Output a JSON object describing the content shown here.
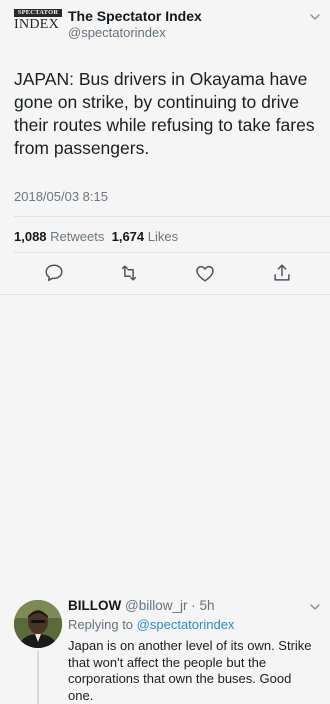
{
  "tweet": {
    "logo_top": "SPECTATOR",
    "logo_bottom": "INDEX",
    "name": "The Spectator Index",
    "handle": "@spectatorindex",
    "text": "JAPAN: Bus drivers in Okayama  have gone on strike, by continuing to drive their routes while refusing to take fares from passengers.",
    "timestamp": "2018/05/03 8:15",
    "retweets_count": "1,088",
    "retweets_label": "Retweets",
    "likes_count": "1,674",
    "likes_label": "Likes"
  },
  "actions": [
    "comment-icon",
    "retweet-icon",
    "heart-icon",
    "share-icon"
  ],
  "reply": {
    "name": "BILLOW",
    "handle_time": "@billow_jr · 5h",
    "replying_prefix": "Replying to",
    "replying_to": "@spectatorindex",
    "text": "Japan is on another level of its own. Strike that won't affect the people but the corporations that own the buses. Good one."
  },
  "colors": {
    "background": "#f4f5f4",
    "text": "#1c1e20",
    "muted": "#6d7780",
    "link": "#2a8bd0",
    "divider": "#dfe2e5"
  }
}
